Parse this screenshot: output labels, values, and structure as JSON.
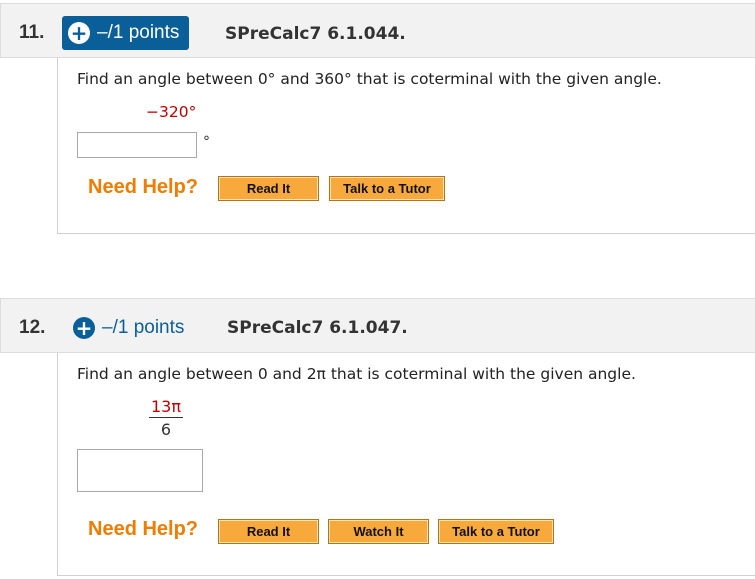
{
  "q11": {
    "number": "11.",
    "points": "–/1 points",
    "source": "SPreCalc7 6.1.044.",
    "prompt": "Find an angle between 0° and 360° that is coterminal with the given angle.",
    "given": "−320°",
    "answer_value": "",
    "unit": "°",
    "help_label": "Need Help?",
    "buttons": [
      "Read It",
      "Talk to a Tutor"
    ]
  },
  "q12": {
    "number": "12.",
    "points": "–/1 points",
    "source": "SPreCalc7 6.1.047.",
    "prompt": "Find an angle between 0 and 2π that is coterminal with the given angle.",
    "given_numerator": "13π",
    "given_denominator": "6",
    "answer_value": "",
    "help_label": "Need Help?",
    "buttons": [
      "Read It",
      "Watch It",
      "Talk to a Tutor"
    ]
  },
  "colors": {
    "accent": "#0a5f99",
    "given": "#c00000",
    "help": "#f07c00",
    "button": "#f8a93c"
  }
}
